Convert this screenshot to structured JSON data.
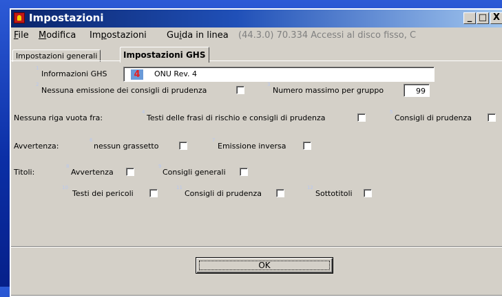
{
  "window": {
    "title": "Impostazioni",
    "min_label": "_",
    "max_label": "□",
    "close_label": "X"
  },
  "menu": {
    "file": "ile",
    "file_key": "F",
    "modifica": "odifica",
    "modifica_key": "M",
    "impostazioni_pre": "Im",
    "impostazioni_key": "p",
    "impostazioni_post": "ostazioni",
    "guida_pre": "Gu",
    "guida_key": "i",
    "guida_post": "da in linea",
    "status": "(44.3.0) 70.334 Accessi al disco fisso, C"
  },
  "tabs": [
    "Impostazioni generali",
    "Impostazioni GHS"
  ],
  "panel": {
    "n1": "1",
    "info_ghs_label": "Informazioni GHS",
    "ghs_value_number": "4",
    "ghs_value_text": "ONU Rev. 4",
    "n2": "2",
    "no_emissione": "Nessuna emissione dei consigli di prudenza",
    "n3": "3",
    "max_gruppo": "Numero massimo per gruppo",
    "max_gruppo_value": "99",
    "nessuna_riga": "Nessuna riga vuota fra:",
    "n4": "4",
    "testi_frasi": "Testi delle frasi di rischio e consigli di prudenza",
    "n5": "5",
    "consigli_prudenza_1": "Consigli di prudenza",
    "avvertenza_label": "Avvertenza:",
    "n6": "6",
    "nessun_grassetto": "nessun grassetto",
    "n7": "7",
    "emissione_inversa": "Emissione inversa",
    "titoli_label": "Titoli:",
    "n8": "8",
    "avvertenza_cb": "Avvertenza",
    "n9": "9",
    "consigli_generali": "Consigli generali",
    "n10": "10",
    "testi_pericoli": "Testi dei pericoli",
    "n11": "11",
    "consigli_prudenza_2": "Consigli di prudenza",
    "n12": "12",
    "sottotitoli": "Sottotitoli"
  },
  "ok_button": "OK"
}
